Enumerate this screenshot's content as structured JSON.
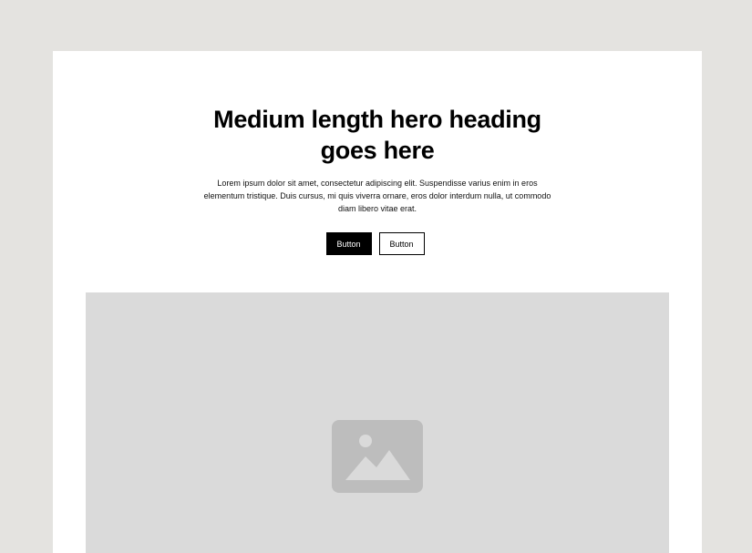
{
  "hero": {
    "heading_line1": "Medium length hero heading",
    "heading_line2": "goes here",
    "description_line1": "Lorem ipsum dolor sit amet, consectetur adipiscing elit. Suspendisse varius enim in eros",
    "description_line2": "elementum tristique. Duis cursus, mi quis viverra ornare, eros dolor interdum nulla, ut commodo",
    "description_line3": "diam libero vitae erat.",
    "primary_button_label": "Button",
    "secondary_button_label": "Button"
  },
  "media": {
    "icon": "image-icon",
    "placeholder_color": "#dadada",
    "icon_color": "#bdbdbd"
  },
  "colors": {
    "page_background": "#e4e3e0",
    "frame_background": "#ffffff",
    "primary_button": "#000000"
  }
}
